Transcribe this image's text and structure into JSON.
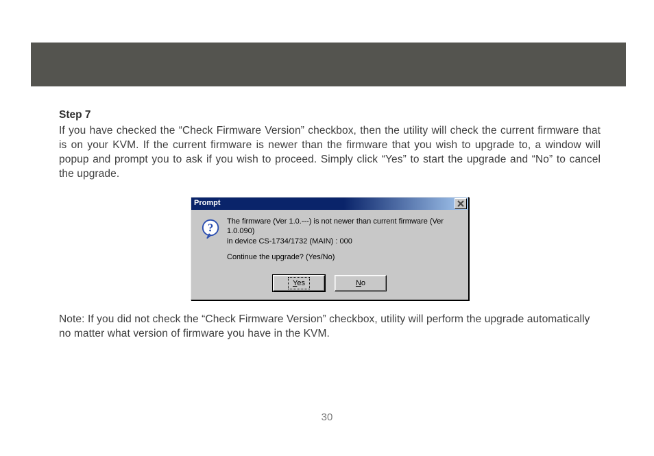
{
  "step": {
    "title": "Step 7"
  },
  "paragraph": "If you have checked the “Check Firmware Version” checkbox, then the utility will check the current firmware that is on your KVM. If the current firmware is newer than the firmware that you wish to upgrade to, a window will popup and prompt you to ask if you wish to proceed. Simply click “Yes” to start the upgrade and “No” to cancel the upgrade.",
  "dialog": {
    "title": "Prompt",
    "line1": "The firmware (Ver 1.0.---) is not newer than current firmware (Ver 1.0.090)",
    "line2": " in device CS-1734/1732 (MAIN) : 000",
    "line3": "Continue the upgrade? (Yes/No)",
    "buttons": {
      "yes": "Yes",
      "no": "No"
    },
    "icons": {
      "question": "question-mark-icon",
      "close": "close-icon"
    }
  },
  "note": "Note: If you did not check the “Check Firmware Version” checkbox, utility will perform the upgrade automatically no matter what version of firmware you have in the KVM.",
  "page_number": "30"
}
